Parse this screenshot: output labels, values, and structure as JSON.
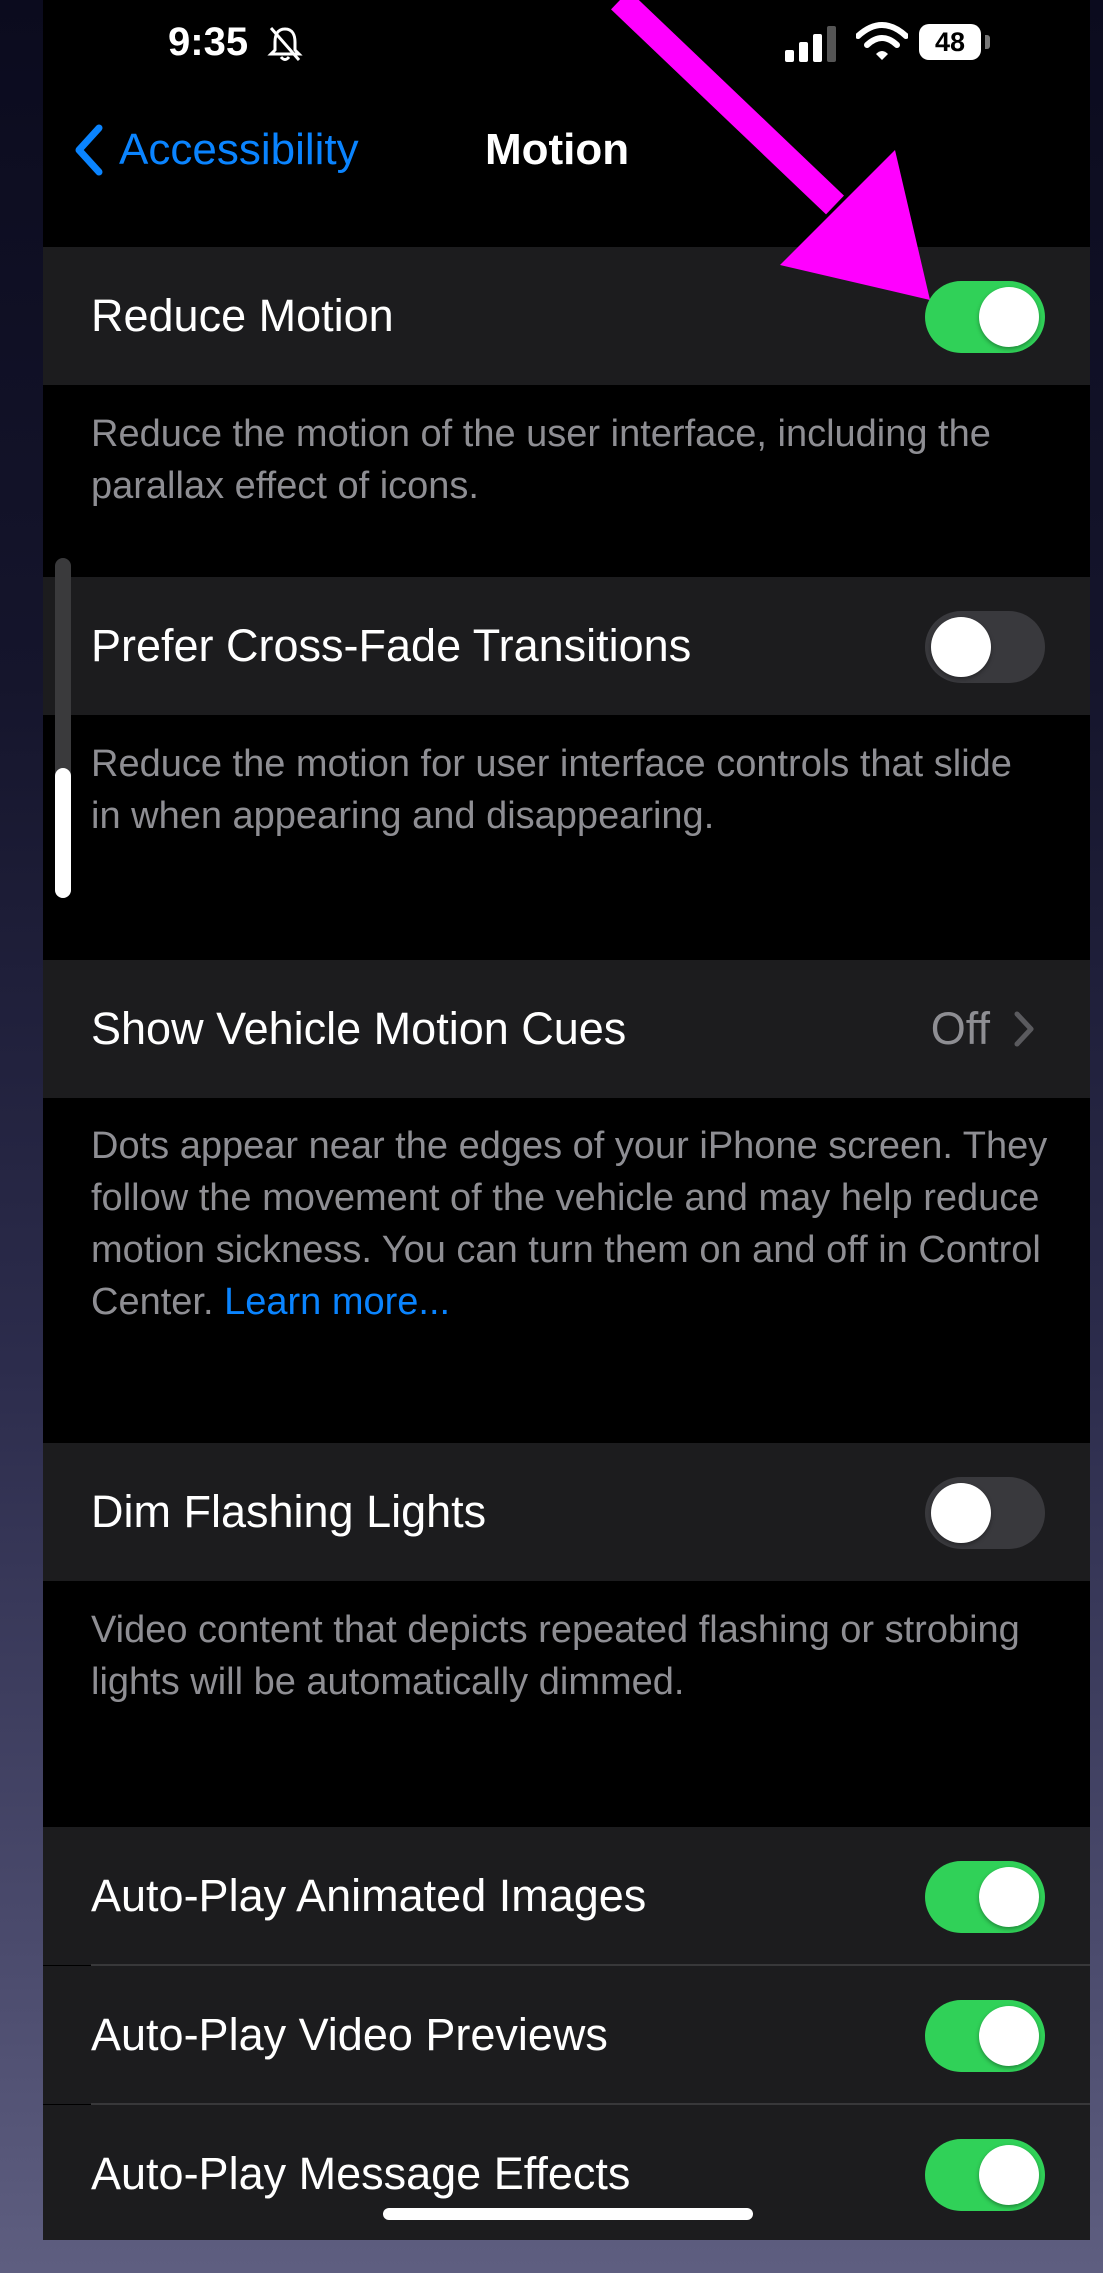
{
  "status_bar": {
    "time": "9:35",
    "battery": "48"
  },
  "nav": {
    "back_label": "Accessibility",
    "title": "Motion"
  },
  "settings": {
    "reduce_motion": {
      "label": "Reduce Motion",
      "on": true,
      "footer": "Reduce the motion of the user interface, including the parallax effect of icons."
    },
    "cross_fade": {
      "label": "Prefer Cross-Fade Transitions",
      "on": false,
      "footer": "Reduce the motion for user interface controls that slide in when appearing and disappearing."
    },
    "vehicle_cues": {
      "label": "Show Vehicle Motion Cues",
      "value": "Off",
      "footer": "Dots appear near the edges of your iPhone screen. They follow the movement of the vehicle and may help reduce motion sickness. You can turn them on and off in Control Center.",
      "link": "Learn more..."
    },
    "dim_flashing": {
      "label": "Dim Flashing Lights",
      "on": false,
      "footer": "Video content that depicts repeated flashing or strobing lights will be automatically dimmed."
    },
    "autoplay_images": {
      "label": "Auto-Play Animated Images",
      "on": true
    },
    "autoplay_video": {
      "label": "Auto-Play Video Previews",
      "on": true
    },
    "autoplay_message": {
      "label": "Auto-Play Message Effects",
      "on": true
    }
  },
  "colors": {
    "accent": "#0a84ff",
    "toggle_on": "#30d158",
    "toggle_off": "#39393d",
    "annotation_arrow": "#ff00ff"
  }
}
